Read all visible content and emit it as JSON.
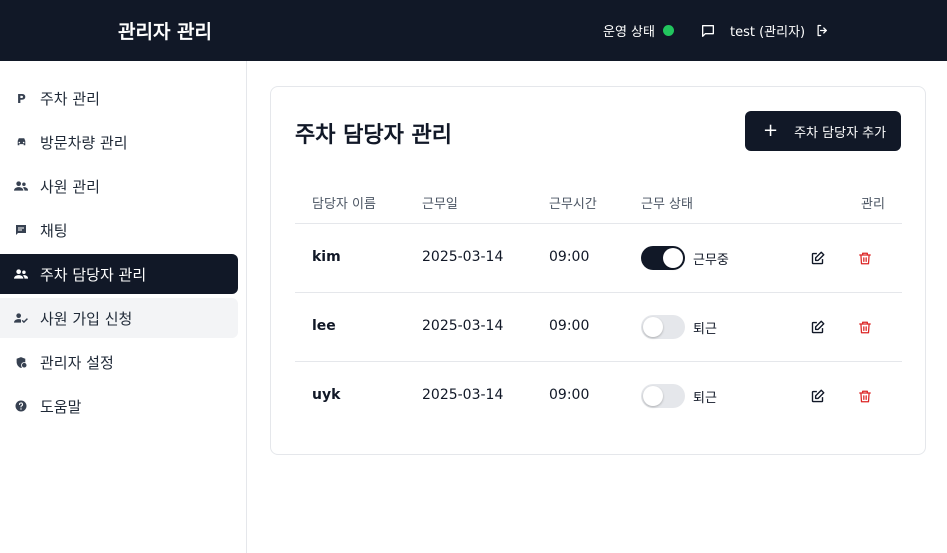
{
  "header": {
    "app_title": "관리자 관리",
    "status_label": "운영 상태",
    "status_color": "#22c55e",
    "user_label": "test (관리자)"
  },
  "sidebar": {
    "items": [
      {
        "label": "주차 관리",
        "icon": "parking-icon"
      },
      {
        "label": "방문차량 관리",
        "icon": "car-icon"
      },
      {
        "label": "사원 관리",
        "icon": "people-icon"
      },
      {
        "label": "채팅",
        "icon": "chat-icon"
      },
      {
        "label": "주차 담당자 관리",
        "icon": "people-icon",
        "active": true
      },
      {
        "label": "사원 가입 신청",
        "icon": "user-check-icon"
      },
      {
        "label": "관리자 설정",
        "icon": "admin-settings-icon"
      },
      {
        "label": "도움말",
        "icon": "help-icon"
      }
    ]
  },
  "main": {
    "title": "주차 담당자 관리",
    "add_button_label": "주차 담당자 추가",
    "columns": [
      "담당자 이름",
      "근무일",
      "근무시간",
      "근무 상태",
      "관리"
    ],
    "rows": [
      {
        "name": "kim",
        "date": "2025-03-14",
        "time": "09:00",
        "on_duty": true,
        "status": "근무중"
      },
      {
        "name": "lee",
        "date": "2025-03-14",
        "time": "09:00",
        "on_duty": false,
        "status": "퇴근"
      },
      {
        "name": "uyk",
        "date": "2025-03-14",
        "time": "09:00",
        "on_duty": false,
        "status": "퇴근"
      }
    ]
  },
  "colors": {
    "primary": "#111827",
    "delete": "#dc2626",
    "online": "#22c55e"
  }
}
